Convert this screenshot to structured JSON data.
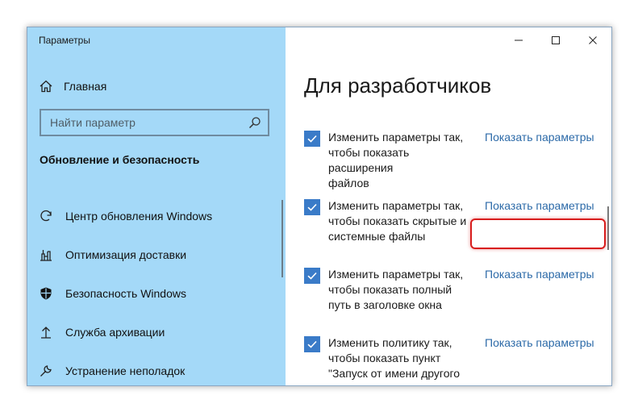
{
  "window": {
    "title": "Параметры",
    "controls": [
      "minimize",
      "maximize",
      "close"
    ]
  },
  "sidebar": {
    "home_label": "Главная",
    "search": {
      "placeholder": "Найти параметр"
    },
    "section_title": "Обновление и безопасность",
    "items": [
      {
        "label": "Центр обновления Windows",
        "icon": "refresh-icon"
      },
      {
        "label": "Оптимизация доставки",
        "icon": "delivery-icon"
      },
      {
        "label": "Безопасность Windows",
        "icon": "shield-icon"
      },
      {
        "label": "Служба архивации",
        "icon": "backup-icon"
      },
      {
        "label": "Устранение неполадок",
        "icon": "wrench-icon"
      }
    ]
  },
  "main": {
    "title": "Для разработчиков",
    "options": [
      {
        "lines": [
          "Изменить параметры так,",
          "чтобы показать расширения",
          "файлов"
        ],
        "checked": true,
        "link": "Показать параметры"
      },
      {
        "lines": [
          "Изменить параметры так,",
          "чтобы показать скрытые и",
          "системные файлы"
        ],
        "checked": true,
        "link": "Показать параметры",
        "highlighted": true
      },
      {
        "lines": [
          "Изменить параметры так,",
          "чтобы показать полный",
          "путь в заголовке окна"
        ],
        "checked": true,
        "link": "Показать параметры"
      },
      {
        "lines": [
          "Изменить политику так,",
          "чтобы показать пункт",
          "\"Запуск от имени другого"
        ],
        "checked": true,
        "link": "Показать параметры"
      }
    ]
  },
  "colors": {
    "sidebar_bg": "#a4d9f8",
    "checkbox": "#3a7bc8",
    "link": "#2c6aa8",
    "highlight": "#d81e1e"
  }
}
